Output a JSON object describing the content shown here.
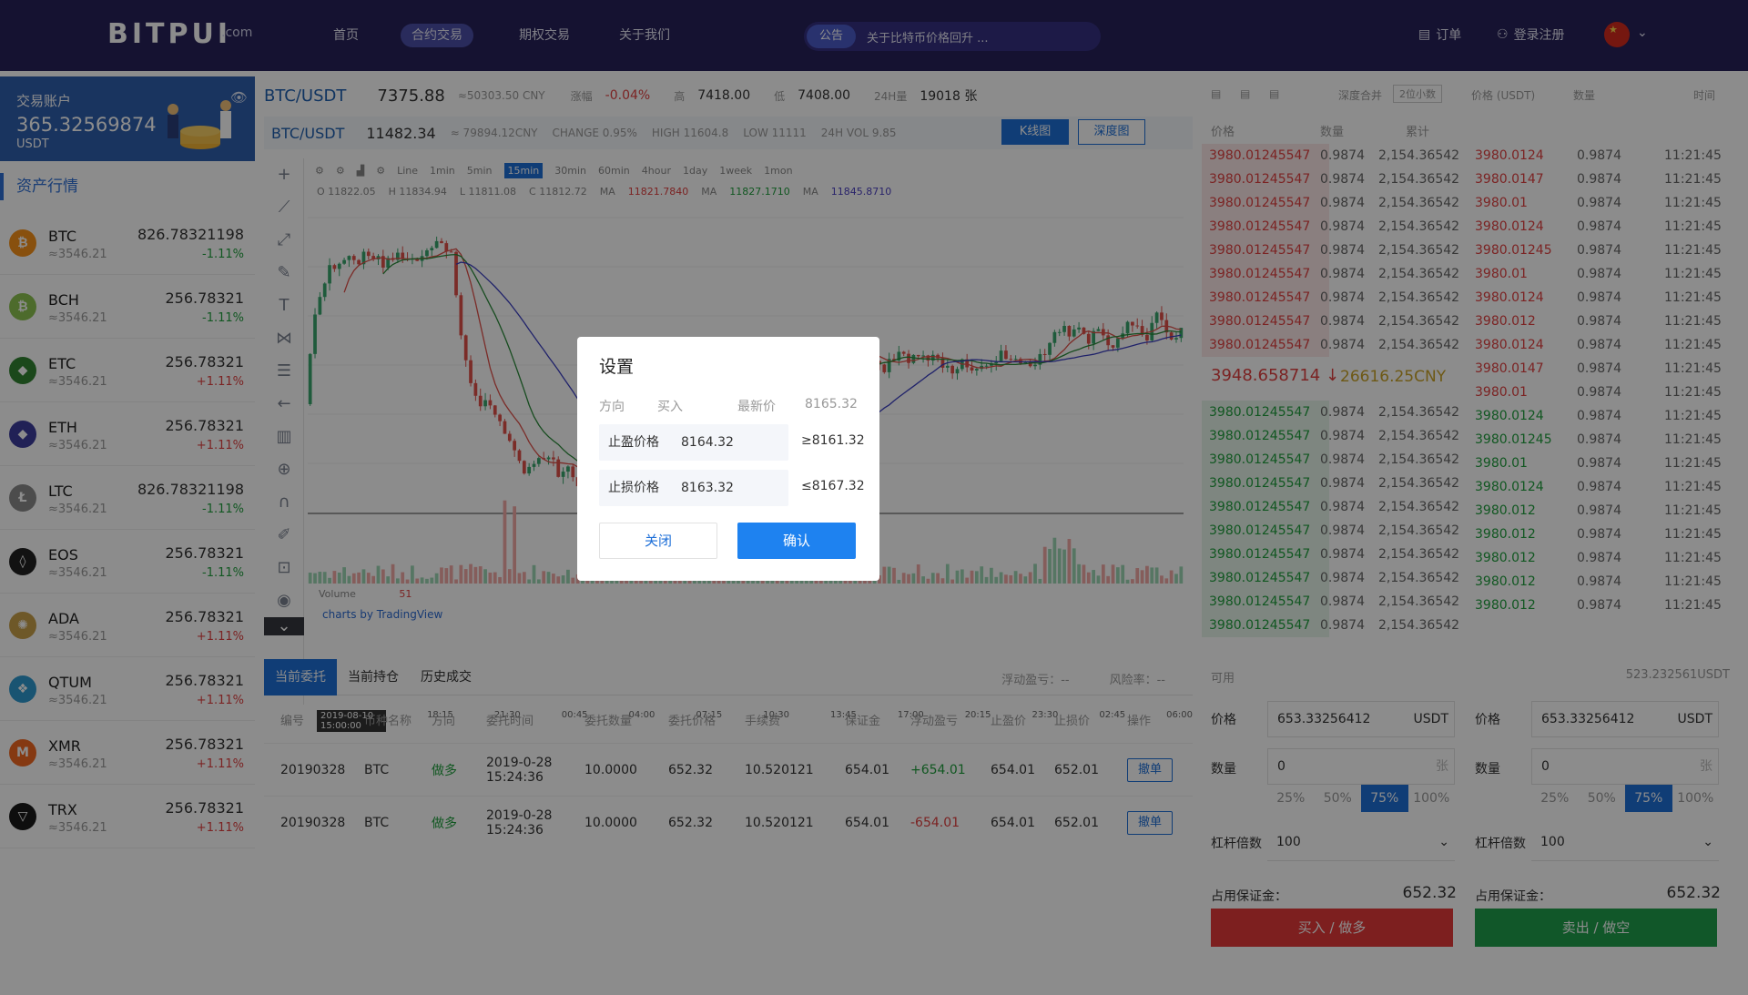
{
  "nav": {
    "logo": "BITPUI",
    "logo_suffix": ".com",
    "items": [
      "首页",
      "合约交易",
      "期权交易",
      "关于我们"
    ],
    "active_index": 1,
    "notice_tag": "公告",
    "notice_text": "关于比特币价格回升 ...",
    "orders": "订单",
    "login": "登录注册"
  },
  "account": {
    "title": "交易账户",
    "balance": "365.32569874",
    "unit": "USDT"
  },
  "market": {
    "title": "资产行情",
    "coins": [
      {
        "name": "BTC",
        "sub": "≈3546.21",
        "price": "826.78321198",
        "change": "-1.11%",
        "dir": "down",
        "icon": "bitcoin-icon",
        "color": "#f7931a",
        "glyph": "₿"
      },
      {
        "name": "BCH",
        "sub": "≈3546.21",
        "price": "256.78321",
        "change": "-1.11%",
        "dir": "down",
        "icon": "bitcoin-cash-icon",
        "color": "#8dc351",
        "glyph": "₿"
      },
      {
        "name": "ETC",
        "sub": "≈3546.21",
        "price": "256.78321",
        "change": "+1.11%",
        "dir": "up",
        "icon": "ethereum-classic-icon",
        "color": "#328332",
        "glyph": "◆"
      },
      {
        "name": "ETH",
        "sub": "≈3546.21",
        "price": "256.78321",
        "change": "+1.11%",
        "dir": "up",
        "icon": "ethereum-icon",
        "color": "#3c3c9d",
        "glyph": "◆"
      },
      {
        "name": "LTC",
        "sub": "≈3546.21",
        "price": "826.78321198",
        "change": "-1.11%",
        "dir": "down",
        "icon": "litecoin-icon",
        "color": "#8a8a8a",
        "glyph": "Ł"
      },
      {
        "name": "EOS",
        "sub": "≈3546.21",
        "price": "256.78321",
        "change": "-1.11%",
        "dir": "down",
        "icon": "eos-icon",
        "color": "#222222",
        "glyph": "◊"
      },
      {
        "name": "ADA",
        "sub": "≈3546.21",
        "price": "256.78321",
        "change": "+1.11%",
        "dir": "up",
        "icon": "cardano-icon",
        "color": "#c8a04a",
        "glyph": "✺"
      },
      {
        "name": "QTUM",
        "sub": "≈3546.21",
        "price": "256.78321",
        "change": "+1.11%",
        "dir": "up",
        "icon": "qtum-icon",
        "color": "#2e9ad0",
        "glyph": "❖"
      },
      {
        "name": "XMR",
        "sub": "≈3546.21",
        "price": "256.78321",
        "change": "+1.11%",
        "dir": "up",
        "icon": "monero-icon",
        "color": "#f26822",
        "glyph": "M"
      },
      {
        "name": "TRX",
        "sub": "≈3546.21",
        "price": "256.78321",
        "change": "+1.11%",
        "dir": "up",
        "icon": "tron-icon",
        "color": "#1a1a1a",
        "glyph": "▽"
      }
    ]
  },
  "ticker": {
    "pair": "BTC/USDT",
    "price": "7375.88",
    "cny": "≈50303.50 CNY",
    "change_label": "涨幅",
    "change": "-0.04%",
    "high_label": "高",
    "high": "7418.00",
    "low_label": "低",
    "low": "7408.00",
    "vol_label": "24H量",
    "vol": "19018 张"
  },
  "ticker2": {
    "pair": "BTC/USDT",
    "price": "11482.34",
    "cny": "≈ 79894.12CNY",
    "change": "CHANGE 0.95%",
    "high": "HIGH 11604.8",
    "low": "LOW 11111",
    "vol": "24H VOL 9.85",
    "kline_btn": "K线图",
    "depth_btn": "深度图"
  },
  "chart": {
    "intervals": [
      "Line",
      "1min",
      "5min",
      "15min",
      "30min",
      "60min",
      "4hour",
      "1day",
      "1week",
      "1mon"
    ],
    "selected_interval": "15min",
    "ohlc": {
      "o": "O 11822.05",
      "h": "H 11834.94",
      "l": "L 11811.08",
      "c": "C 11812.72"
    },
    "ma_values": [
      "11821.7840",
      "11827.1710",
      "11845.8710"
    ],
    "volume_label": "Volume",
    "volume_value": "51",
    "watermark": "charts by TradingView",
    "xaxis": [
      "2019-08-10 15:00:00",
      "18:15",
      "21:30",
      "00:45",
      "04:00",
      "07:15",
      "10:30",
      "13:45",
      "17:00",
      "20:15",
      "23:30",
      "02:45",
      "06:00"
    ]
  },
  "orders": {
    "tabs": [
      "当前委托",
      "当前持仓",
      "历史成交"
    ],
    "float_pnl": "浮动盈亏：--",
    "risk": "风险率：--",
    "columns": [
      "编号",
      "币种名称",
      "方向",
      "委托时间",
      "委托数量",
      "委托价格",
      "手续费",
      "保证金",
      "浮动盈亏",
      "止盈价",
      "止损价",
      "操作"
    ],
    "rows": [
      {
        "id": "20190328",
        "coin": "BTC",
        "dir": "做多",
        "time": "2019-0-28 15:24:36",
        "qty": "10.0000",
        "price": "652.32",
        "fee": "10.520121",
        "margin": "654.01",
        "pnl": "+654.01",
        "pnl_dir": "down",
        "tp": "654.01",
        "sl": "652.01",
        "action": "撤单"
      },
      {
        "id": "20190328",
        "coin": "BTC",
        "dir": "做多",
        "time": "2019-0-28 15:24:36",
        "qty": "10.0000",
        "price": "652.32",
        "fee": "10.520121",
        "margin": "654.01",
        "pnl": "-654.01",
        "pnl_dir": "up",
        "tp": "654.01",
        "sl": "652.01",
        "action": "撤单"
      }
    ]
  },
  "orderbook": {
    "depth_label": "深度合并",
    "depth_value": "2位小数",
    "headers_left": [
      "价格",
      "数量",
      "累计"
    ],
    "headers_right": [
      "价格 (USDT)",
      "数量",
      "时间"
    ],
    "asks": [
      {
        "price": "3980.01245547",
        "qty": "0.9874",
        "total": "2,154.36542"
      },
      {
        "price": "3980.01245547",
        "qty": "0.9874",
        "total": "2,154.36542"
      },
      {
        "price": "3980.01245547",
        "qty": "0.9874",
        "total": "2,154.36542"
      },
      {
        "price": "3980.01245547",
        "qty": "0.9874",
        "total": "2,154.36542"
      },
      {
        "price": "3980.01245547",
        "qty": "0.9874",
        "total": "2,154.36542"
      },
      {
        "price": "3980.01245547",
        "qty": "0.9874",
        "total": "2,154.36542"
      },
      {
        "price": "3980.01245547",
        "qty": "0.9874",
        "total": "2,154.36542"
      },
      {
        "price": "3980.01245547",
        "qty": "0.9874",
        "total": "2,154.36542"
      },
      {
        "price": "3980.01245547",
        "qty": "0.9874",
        "total": "2,154.36542"
      }
    ],
    "last_price": "3948.658714 ↓",
    "last_cny": "26616.25CNY",
    "bids": [
      {
        "price": "3980.01245547",
        "qty": "0.9874",
        "total": "2,154.36542"
      },
      {
        "price": "3980.01245547",
        "qty": "0.9874",
        "total": "2,154.36542"
      },
      {
        "price": "3980.01245547",
        "qty": "0.9874",
        "total": "2,154.36542"
      },
      {
        "price": "3980.01245547",
        "qty": "0.9874",
        "total": "2,154.36542"
      },
      {
        "price": "3980.01245547",
        "qty": "0.9874",
        "total": "2,154.36542"
      },
      {
        "price": "3980.01245547",
        "qty": "0.9874",
        "total": "2,154.36542"
      },
      {
        "price": "3980.01245547",
        "qty": "0.9874",
        "total": "2,154.36542"
      },
      {
        "price": "3980.01245547",
        "qty": "0.9874",
        "total": "2,154.36542"
      },
      {
        "price": "3980.01245547",
        "qty": "0.9874",
        "total": "2,154.36542"
      },
      {
        "price": "3980.01245547",
        "qty": "0.9874",
        "total": "2,154.36542"
      }
    ],
    "trades": [
      {
        "price": "3980.0124",
        "qty": "0.9874",
        "time": "11:21:45",
        "dir": "up"
      },
      {
        "price": "3980.0147",
        "qty": "0.9874",
        "time": "11:21:45",
        "dir": "up"
      },
      {
        "price": "3980.01",
        "qty": "0.9874",
        "time": "11:21:45",
        "dir": "up"
      },
      {
        "price": "3980.0124",
        "qty": "0.9874",
        "time": "11:21:45",
        "dir": "up"
      },
      {
        "price": "3980.01245",
        "qty": "0.9874",
        "time": "11:21:45",
        "dir": "up"
      },
      {
        "price": "3980.01",
        "qty": "0.9874",
        "time": "11:21:45",
        "dir": "up"
      },
      {
        "price": "3980.0124",
        "qty": "0.9874",
        "time": "11:21:45",
        "dir": "up"
      },
      {
        "price": "3980.012",
        "qty": "0.9874",
        "time": "11:21:45",
        "dir": "up"
      },
      {
        "price": "3980.0124",
        "qty": "0.9874",
        "time": "11:21:45",
        "dir": "up"
      },
      {
        "price": "3980.0147",
        "qty": "0.9874",
        "time": "11:21:45",
        "dir": "up"
      },
      {
        "price": "3980.01",
        "qty": "0.9874",
        "time": "11:21:45",
        "dir": "up"
      },
      {
        "price": "3980.0124",
        "qty": "0.9874",
        "time": "11:21:45",
        "dir": "down"
      },
      {
        "price": "3980.01245",
        "qty": "0.9874",
        "time": "11:21:45",
        "dir": "down"
      },
      {
        "price": "3980.01",
        "qty": "0.9874",
        "time": "11:21:45",
        "dir": "down"
      },
      {
        "price": "3980.0124",
        "qty": "0.9874",
        "time": "11:21:45",
        "dir": "down"
      },
      {
        "price": "3980.012",
        "qty": "0.9874",
        "time": "11:21:45",
        "dir": "down"
      },
      {
        "price": "3980.012",
        "qty": "0.9874",
        "time": "11:21:45",
        "dir": "down"
      },
      {
        "price": "3980.012",
        "qty": "0.9874",
        "time": "11:21:45",
        "dir": "down"
      },
      {
        "price": "3980.012",
        "qty": "0.9874",
        "time": "11:21:45",
        "dir": "down"
      },
      {
        "price": "3980.012",
        "qty": "0.9874",
        "time": "11:21:45",
        "dir": "down"
      }
    ]
  },
  "trade": {
    "avail_label": "可用",
    "avail_value": "523.232561USDT",
    "price_label": "价格",
    "price_value": "653.33256412",
    "unit": "USDT",
    "qty_label": "数量",
    "qty_value": "0",
    "qty_unit": "张",
    "percents": [
      "25%",
      "50%",
      "75%",
      "100%"
    ],
    "selected_percent": "75%",
    "leverage_label": "杠杆倍数",
    "leverage_value": "100",
    "margin_label": "占用保证金：",
    "margin_value": "652.32",
    "buy_label": "买入 / 做多",
    "sell_label": "卖出 / 做空"
  },
  "modal": {
    "title": "设置",
    "dir_label": "方向",
    "dir_value": "买入",
    "last_label": "最新价",
    "last_value": "8165.32",
    "tp_label": "止盈价格",
    "tp_value": "8164.32",
    "tp_hint": "≥8161.32",
    "sl_label": "止损价格",
    "sl_value": "8163.32",
    "sl_hint": "≤8167.32",
    "close_label": "关闭",
    "ok_label": "确认"
  },
  "colors": {
    "nav_bg": "#27225a",
    "accent": "#1e6fd8",
    "up": "#e04040",
    "down": "#1f9e3d"
  }
}
